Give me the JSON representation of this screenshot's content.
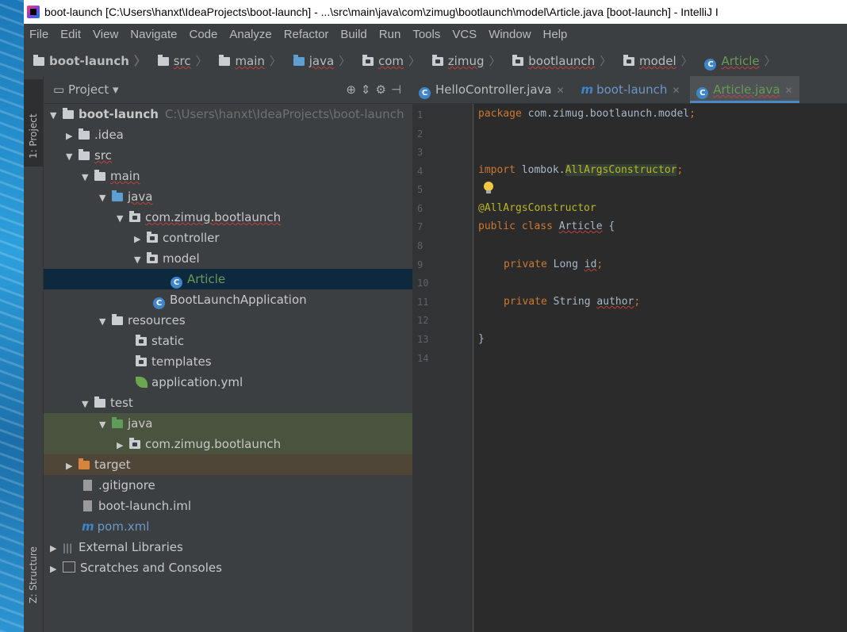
{
  "window": {
    "title": "boot-launch [C:\\Users\\hanxt\\IdeaProjects\\boot-launch] - ...\\src\\main\\java\\com\\zimug\\bootlaunch\\model\\Article.java [boot-launch] - IntelliJ I"
  },
  "menu": [
    "File",
    "Edit",
    "View",
    "Navigate",
    "Code",
    "Analyze",
    "Refactor",
    "Build",
    "Run",
    "Tools",
    "VCS",
    "Window",
    "Help"
  ],
  "breadcrumbs": [
    "boot-launch",
    "src",
    "main",
    "java",
    "com",
    "zimug",
    "bootlaunch",
    "model",
    "Article"
  ],
  "side_tabs": {
    "project": "1: Project",
    "structure": "Z: Structure"
  },
  "project_panel": {
    "title": "Project",
    "tree": [
      {
        "label": "boot-launch",
        "path": "C:\\Users\\hanxt\\IdeaProjects\\boot-launch"
      },
      {
        "label": ".idea"
      },
      {
        "label": "src"
      },
      {
        "label": "main"
      },
      {
        "label": "java"
      },
      {
        "label": "com.zimug.bootlaunch"
      },
      {
        "label": "controller"
      },
      {
        "label": "model"
      },
      {
        "label": "Article"
      },
      {
        "label": "BootLaunchApplication"
      },
      {
        "label": "resources"
      },
      {
        "label": "static"
      },
      {
        "label": "templates"
      },
      {
        "label": "application.yml"
      },
      {
        "label": "test"
      },
      {
        "label": "java"
      },
      {
        "label": "com.zimug.bootlaunch"
      },
      {
        "label": "target"
      },
      {
        "label": ".gitignore"
      },
      {
        "label": "boot-launch.iml"
      },
      {
        "label": "pom.xml"
      },
      {
        "label": "External Libraries"
      },
      {
        "label": "Scratches and Consoles"
      }
    ]
  },
  "editor_tabs": [
    {
      "label": "HelloController.java"
    },
    {
      "label": "boot-launch"
    },
    {
      "label": "Article.java"
    }
  ],
  "code": {
    "pkg_kw": "package",
    "pkg_name": "com.zimug.bootlaunch.model",
    "import_kw": "import",
    "import_pkg": "lombok.",
    "import_cls": "AllArgsConstructor",
    "annotation": "@AllArgsConstructor",
    "class_kw": "public class",
    "class_name": "Article",
    "brace_open": "{",
    "private_kw": "private",
    "type_long": "Long",
    "field_id": "id",
    "type_string": "String",
    "field_author": "author",
    "brace_close": "}",
    "semicolon": ";",
    "line_numbers": [
      "1",
      "2",
      "3",
      "4",
      "5",
      "6",
      "7",
      "8",
      "9",
      "10",
      "11",
      "12",
      "13",
      "14"
    ]
  }
}
